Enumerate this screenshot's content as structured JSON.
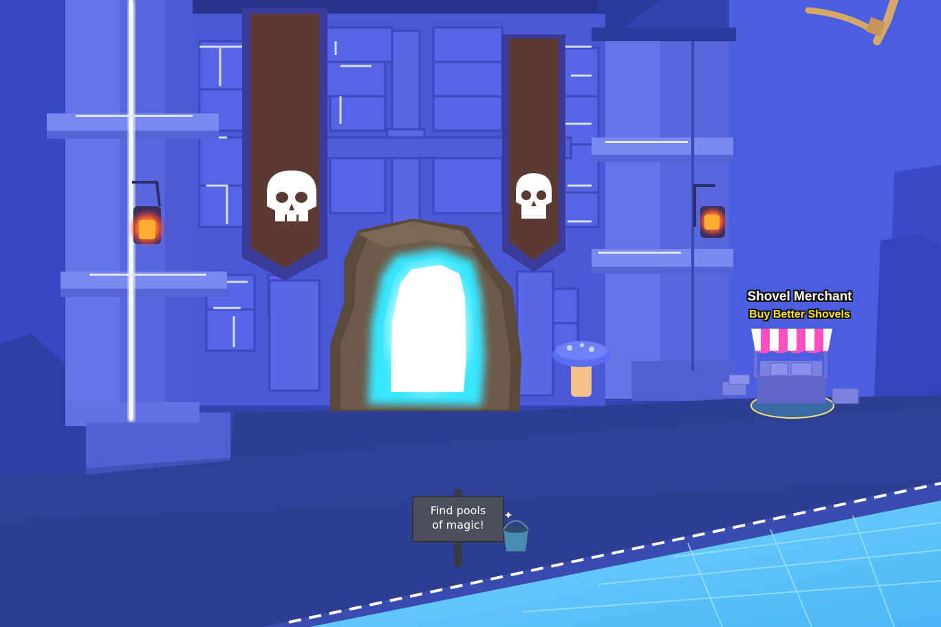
{
  "npc": {
    "name": "Shovel Merchant",
    "subtitle": "Buy Better Shovels"
  },
  "sign": {
    "line1": "Find pools",
    "line2": "of magic!"
  },
  "colors": {
    "wall": "#4a58d8",
    "wall_dark": "#3a46b8",
    "floor": "#2d3d8f",
    "glow": "#cfd8ff",
    "banner": "#5a3a32",
    "portal": "#7ff4ff",
    "water": "#5ec8ff",
    "awning_pink": "#ff4fc0",
    "npc_subtitle": "#ffe21a"
  }
}
